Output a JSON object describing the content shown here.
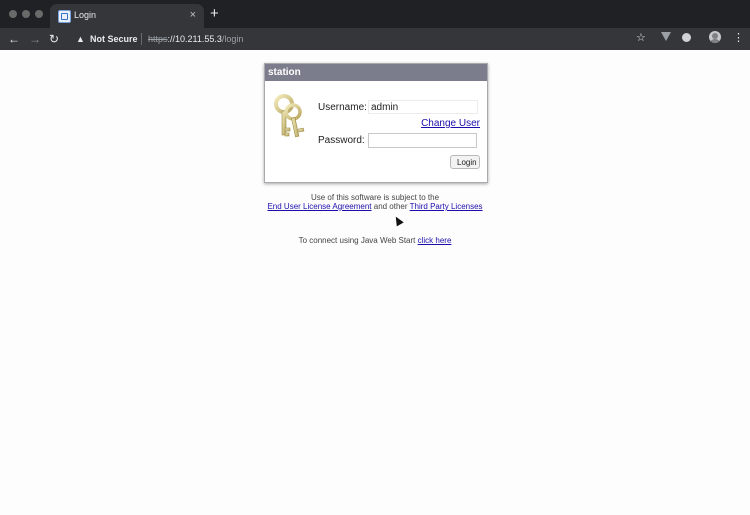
{
  "browser": {
    "tab_title": "Login",
    "tab_close": "×",
    "new_tab": "+",
    "security_label": "Not Secure",
    "url_scheme": "https",
    "url_host": "://10.211.55.3",
    "url_path": "/login",
    "icons": [
      "back-arrow-icon",
      "forward-arrow-icon",
      "reload-icon",
      "warning-icon",
      "star-icon",
      "extension-icon",
      "profile-icon",
      "menu-icon"
    ]
  },
  "login": {
    "header": "station",
    "username_label": "Username:",
    "username_value": "admin",
    "change_user": "Change User",
    "password_label": "Password:",
    "password_value": "",
    "login_button": "Login"
  },
  "footer": {
    "notice_text": "Use of this software is subject to the",
    "eula_link": "End User License Agreement",
    "and_other": " and other ",
    "third_party_link": "Third Party Licenses",
    "java_text": "To connect using Java Web Start ",
    "java_link": "click here"
  },
  "colors": {
    "header_bg": "#7b7d8c",
    "link": "#1a0dab",
    "chrome_dark": "#202124",
    "chrome_toolbar": "#35363a"
  }
}
